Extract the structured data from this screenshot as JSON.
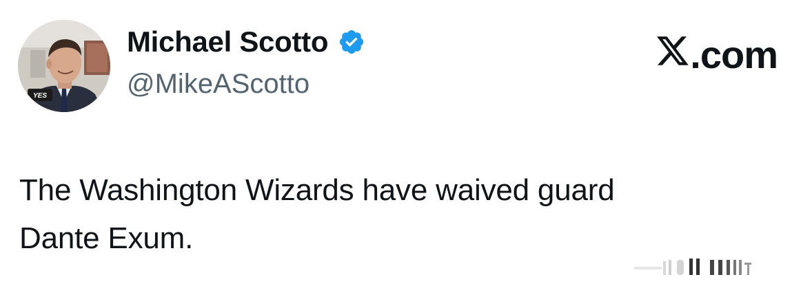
{
  "author": {
    "name": "Michael Scotto",
    "handle": "@MikeAScotto",
    "verified": true,
    "verified_color": "#1d9bf0"
  },
  "brand": {
    "label": ".com",
    "icon": "x-logo-icon"
  },
  "tweet": {
    "line1": "The Washington Wizards have waived guard",
    "line2": "Dante Exum."
  },
  "avatar": {
    "badge_text": "YES"
  },
  "colors": {
    "text": "#0f1419",
    "secondary": "#536471",
    "background": "#ffffff"
  }
}
